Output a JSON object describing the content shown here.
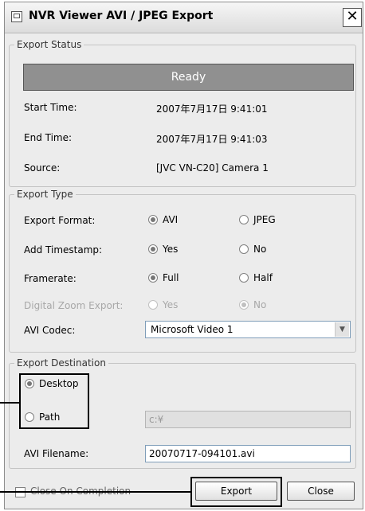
{
  "window": {
    "title": "NVR Viewer AVI / JPEG Export",
    "close_symbol": "✕"
  },
  "export_status": {
    "legend": "Export Status",
    "status": "Ready",
    "start_time_label": "Start Time:",
    "start_time_value": "2007年7月17日 9:41:01",
    "end_time_label": "End Time:",
    "end_time_value": "2007年7月17日 9:41:03",
    "source_label": "Source:",
    "source_value": "[JVC VN-C20] Camera 1"
  },
  "export_type": {
    "legend": "Export Type",
    "format_label": "Export Format:",
    "format_option_avi": "AVI",
    "format_option_jpeg": "JPEG",
    "format_selected": "AVI",
    "timestamp_label": "Add Timestamp:",
    "timestamp_yes": "Yes",
    "timestamp_no": "No",
    "timestamp_selected": "Yes",
    "framerate_label": "Framerate:",
    "framerate_full": "Full",
    "framerate_half": "Half",
    "framerate_selected": "Full",
    "zoom_label": "Digital Zoom Export:",
    "zoom_yes": "Yes",
    "zoom_no": "No",
    "zoom_selected": "No",
    "codec_label": "AVI Codec:",
    "codec_value": "Microsoft Video 1"
  },
  "export_destination": {
    "legend": "Export Destination",
    "desktop_label": "Desktop",
    "path_label": "Path",
    "selected": "Desktop",
    "path_value": "c:¥",
    "filename_label": "AVI Filename:",
    "filename_value": "20070717-094101.avi"
  },
  "footer": {
    "close_on_completion_label": "Close On Completion",
    "export_button": "Export",
    "close_button": "Close"
  },
  "icons": {
    "app": "app-icon",
    "close": "close-icon",
    "dropdown": "chevron-down-icon"
  },
  "colors": {
    "status_bar": "#909090",
    "window_bg": "#ececec"
  }
}
